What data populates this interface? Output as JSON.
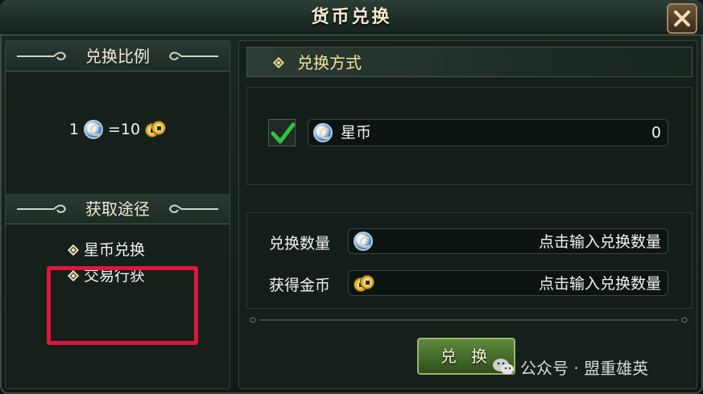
{
  "window": {
    "title": "货币兑换",
    "close_icon": "close-icon"
  },
  "left": {
    "ratio_header": "兑换比例",
    "ratio": {
      "left_amount": "1",
      "equals_text": "=10",
      "left_icon": "star-coin-icon",
      "right_icon": "gold-coin-icon"
    },
    "routes_header": "获取途径",
    "routes": [
      "星币兑换",
      "交易行获"
    ]
  },
  "right": {
    "method_header": "兑换方式",
    "method_option": {
      "checked": true,
      "currency_name": "星币",
      "balance": "0"
    },
    "quantity_label": "兑换数量",
    "quantity_placeholder": "点击输入兑换数量",
    "gold_label": "获得金币",
    "gold_placeholder": "点击输入兑换数量",
    "convert_button": "兑 换"
  },
  "watermark": {
    "text": "公众号 · 盟重雄英"
  },
  "colors": {
    "highlight": "#e0143c",
    "accent_gold": "#f4e29a",
    "check_green": "#35c23c"
  }
}
